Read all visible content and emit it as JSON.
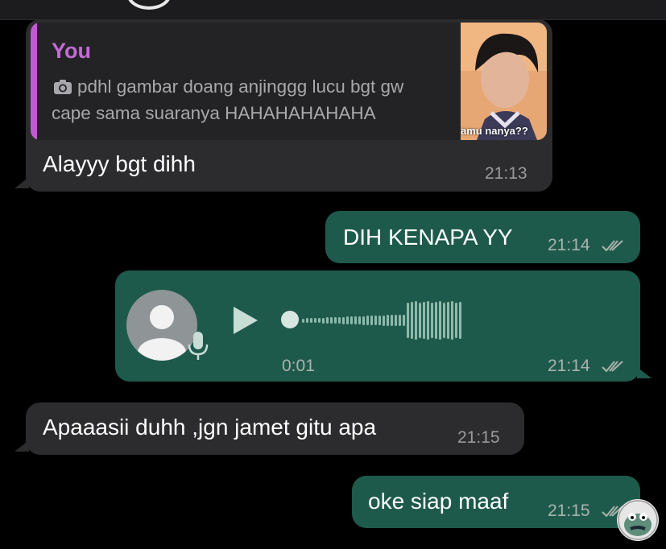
{
  "colors": {
    "background": "#000000",
    "incoming_bubble": "#2c2c2e",
    "outgoing_bubble": "#1e5a4c",
    "reply_accent": "#c05bd0",
    "tick": "#a9b3ad"
  },
  "messages": [
    {
      "direction": "incoming",
      "reply": {
        "author": "You",
        "icon": "camera-icon",
        "line1": "pdhl gambar doang anjinggg lucu bgt gw",
        "line2": "cape sama suaranya HAHAHAHAHAHA",
        "thumbnail_caption": "amu nanya??"
      },
      "text": "Alayyy bgt dihh",
      "time": "21:13"
    },
    {
      "direction": "outgoing",
      "text": "DIH KENAPA YY",
      "time": "21:14",
      "status": "read-ticks-icon"
    },
    {
      "direction": "outgoing",
      "type": "voice",
      "duration": "0:01",
      "progress": 0,
      "time": "21:14",
      "status": "read-ticks-icon"
    },
    {
      "direction": "incoming",
      "text": "Apaaasii duhh ,jgn jamet gitu apa",
      "time": "21:15"
    },
    {
      "direction": "outgoing",
      "text": "oke siap maaf",
      "time": "21:15",
      "status": "read-ticks-icon"
    }
  ]
}
